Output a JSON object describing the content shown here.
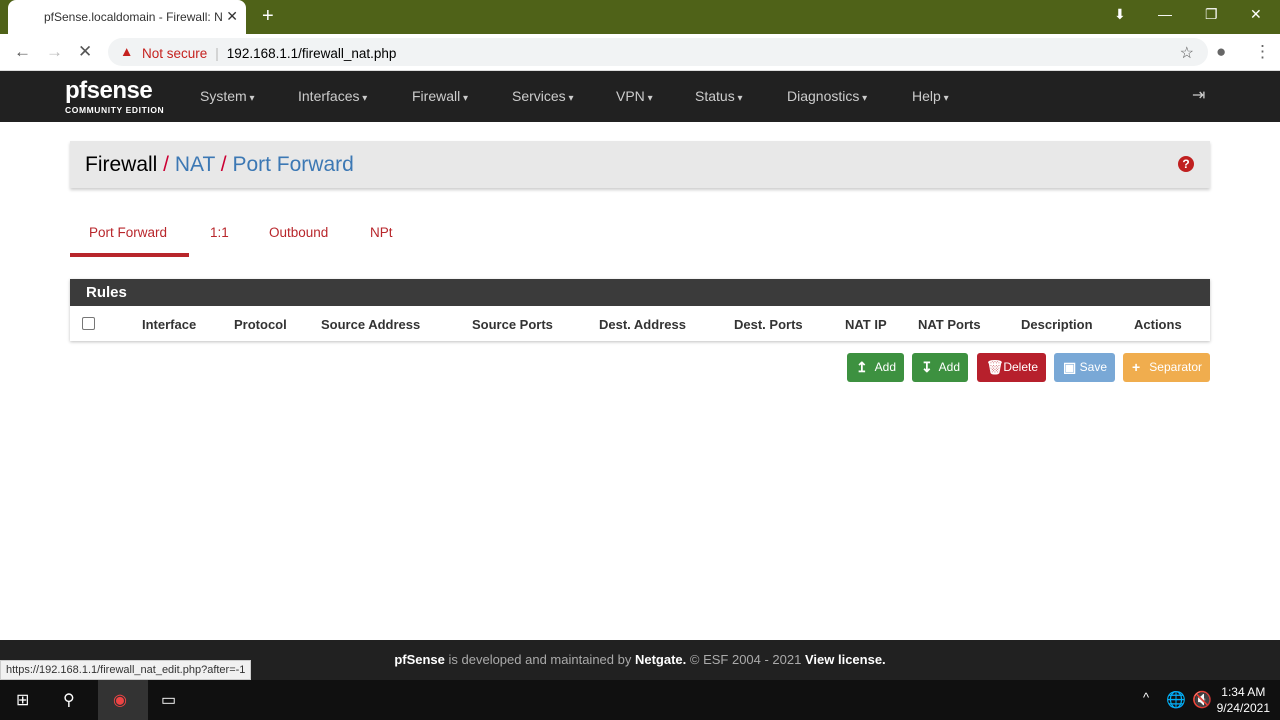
{
  "browser": {
    "tab_title": "pfSense.localdomain - Firewall: N",
    "url": "192.168.1.1/firewall_nat.php",
    "security": "Not secure",
    "status_url": "https://192.168.1.1/firewall_nat_edit.php?after=-1"
  },
  "logo": {
    "name": "pfsense",
    "edition": "COMMUNITY EDITION"
  },
  "menu": [
    "System",
    "Interfaces",
    "Firewall",
    "Services",
    "VPN",
    "Status",
    "Diagnostics",
    "Help"
  ],
  "breadcrumb": [
    "Firewall",
    "NAT",
    "Port Forward"
  ],
  "tabs": [
    "Port Forward",
    "1:1",
    "Outbound",
    "NPt"
  ],
  "panel": {
    "title": "Rules",
    "columns": [
      "Interface",
      "Protocol",
      "Source Address",
      "Source Ports",
      "Dest. Address",
      "Dest. Ports",
      "NAT IP",
      "NAT Ports",
      "Description",
      "Actions"
    ]
  },
  "buttons": {
    "add_top": "Add",
    "add_bottom": "Add",
    "delete": "Delete",
    "save": "Save",
    "separator": "Separator"
  },
  "footer": {
    "brand": "pfSense",
    "text1": " is developed and maintained by ",
    "company": "Netgate.",
    "text2": " © ESF 2004 - 2021 ",
    "license": "View license."
  },
  "taskbar": {
    "time": "1:34 AM",
    "date": "9/24/2021"
  }
}
